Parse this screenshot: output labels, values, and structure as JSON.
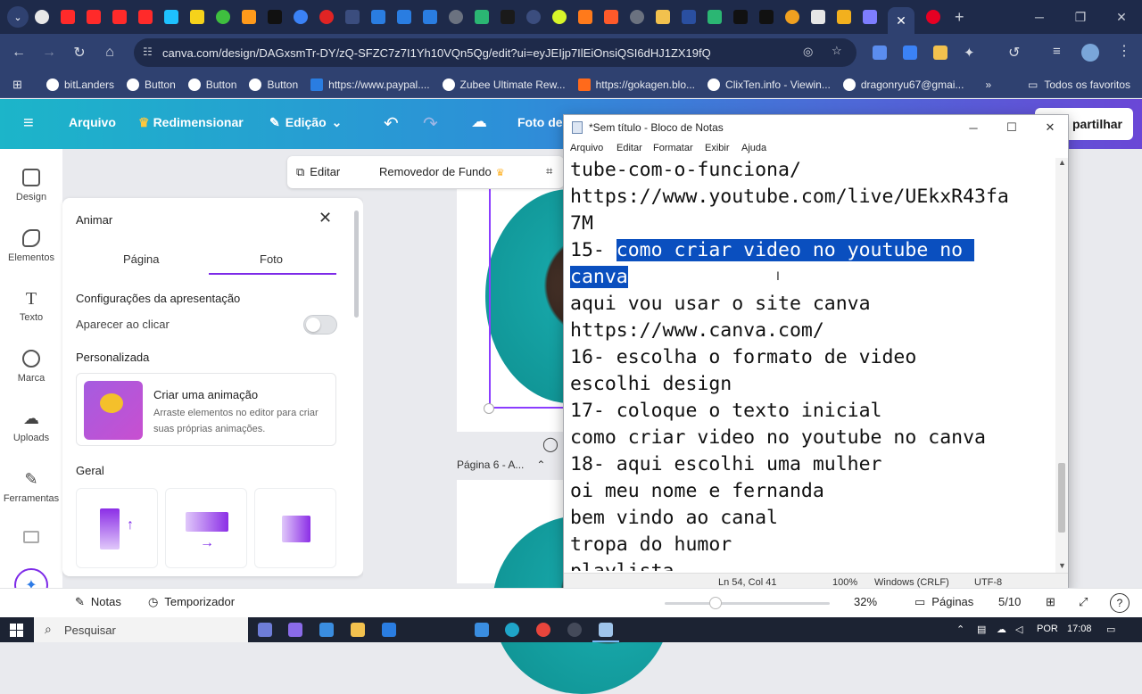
{
  "browser": {
    "url": "canva.com/design/DAGxsmTr-DY/zQ-SFZC7z7I1Yh10VQn5Qg/edit?ui=eyJEIjp7IlEiOnsiQSI6dHJ1ZX19fQ",
    "bookmarks": [
      "bitLanders",
      "Button",
      "Button",
      "Button",
      "https://www.paypal....",
      "Zubee Ultimate Rew...",
      "https://gokagen.blo...",
      "ClixTen.info - Viewin...",
      "dragonryu67@gmai..."
    ],
    "bookmarks_overflow": "»",
    "other_bookmarks": "Todos os favoritos"
  },
  "canva_top": {
    "menu": "Arquivo",
    "resize": "Redimensionar",
    "edit_mode": "Edição",
    "photo": "Foto de",
    "share": "partilhar"
  },
  "rail": {
    "items": [
      "Design",
      "Elementos",
      "Texto",
      "Marca",
      "Uploads",
      "Ferramentas"
    ]
  },
  "toolbar": {
    "edit": "Editar",
    "bg_remover": "Removedor de Fundo"
  },
  "panel": {
    "title": "Animar",
    "tabs": [
      "Página",
      "Foto"
    ],
    "presentation_section": "Configurações da apresentação",
    "appear_on_click": "Aparecer ao clicar",
    "custom_section": "Personalizada",
    "card_title": "Criar uma animação",
    "card_desc": "Arraste elementos no editor para criar suas próprias animações.",
    "general_section": "Geral"
  },
  "canvas": {
    "page_label": "Página 6 - A..."
  },
  "notepad": {
    "title": "*Sem título - Bloco de Notas",
    "menu": [
      "Arquivo",
      "Editar",
      "Formatar",
      "Exibir",
      "Ajuda"
    ],
    "lines": [
      "tube-com-o-funciona/",
      "https://www.youtube.com/live/UEkxR43fa",
      "7M",
      "15- ",
      "como criar video no youtube no ",
      "canva",
      "aqui vou usar o site canva",
      "https://www.canva.com/",
      "16- escolha o formato de video",
      "escolhi design",
      "17- coloque o texto inicial",
      "como criar video no youtube no canva",
      "18- aqui escolhi uma mulher",
      "oi meu nome e fernanda",
      "bem vindo ao canal",
      "tropa do humor",
      "playlista"
    ],
    "status": {
      "position": "Ln 54, Col 41",
      "zoom": "100%",
      "eol": "Windows (CRLF)",
      "encoding": "UTF-8"
    }
  },
  "canva_bottom": {
    "notes": "Notas",
    "timer": "Temporizador",
    "zoom": "32%",
    "pages_label": "Páginas",
    "pages_count": "5/10",
    "help": "?"
  },
  "taskbar": {
    "search_placeholder": "Pesquisar",
    "language": "POR",
    "time": "17:08"
  }
}
